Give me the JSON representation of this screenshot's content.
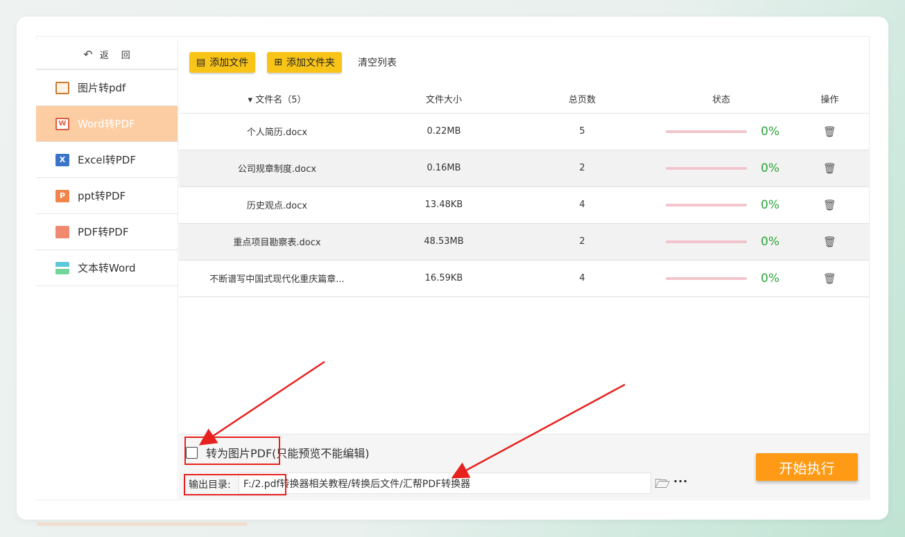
{
  "sidebar": {
    "back_label": "返回",
    "items": [
      {
        "label": "图片转pdf",
        "icon": "image-icon"
      },
      {
        "label": "Word转PDF",
        "icon": "word-icon",
        "active": true,
        "icon_text": "W"
      },
      {
        "label": "Excel转PDF",
        "icon": "excel-icon",
        "icon_text": "X"
      },
      {
        "label": "ppt转PDF",
        "icon": "ppt-icon",
        "icon_text": "P"
      },
      {
        "label": "PDF转PDF",
        "icon": "pdf-icon"
      },
      {
        "label": "文本转Word",
        "icon": "text-icon"
      }
    ]
  },
  "toolbar": {
    "add_file": "添加文件",
    "add_folder": "添加文件夹",
    "clear_list": "清空列表"
  },
  "table": {
    "headers": {
      "name": "▾ 文件名（5）",
      "size": "文件大小",
      "pages": "总页数",
      "status": "状态",
      "action": "操作"
    },
    "rows": [
      {
        "name": "个人简历.docx",
        "size": "0.22MB",
        "pages": "5",
        "progress": "0%"
      },
      {
        "name": "公司规章制度.docx",
        "size": "0.16MB",
        "pages": "2",
        "progress": "0%"
      },
      {
        "name": "历史观点.docx",
        "size": "13.48KB",
        "pages": "4",
        "progress": "0%"
      },
      {
        "name": "重点项目勘察表.docx",
        "size": "48.53MB",
        "pages": "2",
        "progress": "0%"
      },
      {
        "name": "不断谱写中国式现代化重庆篇章...",
        "size": "16.59KB",
        "pages": "4",
        "progress": "0%"
      }
    ]
  },
  "options": {
    "to_image_pdf": "转为图片PDF(只能预览不能编辑)",
    "output_label": "输出目录:",
    "output_path": "F:/2.pdf转换器相关教程/转换后文件/汇帮PDF转换器",
    "more": "···",
    "start": "开始执行"
  },
  "colors": {
    "accent_yellow": "#f9c418",
    "start_orange": "#ff9a17",
    "active_nav": "#fccda3",
    "progress_green": "#2aa43a",
    "annotation_red": "#e8201e"
  }
}
